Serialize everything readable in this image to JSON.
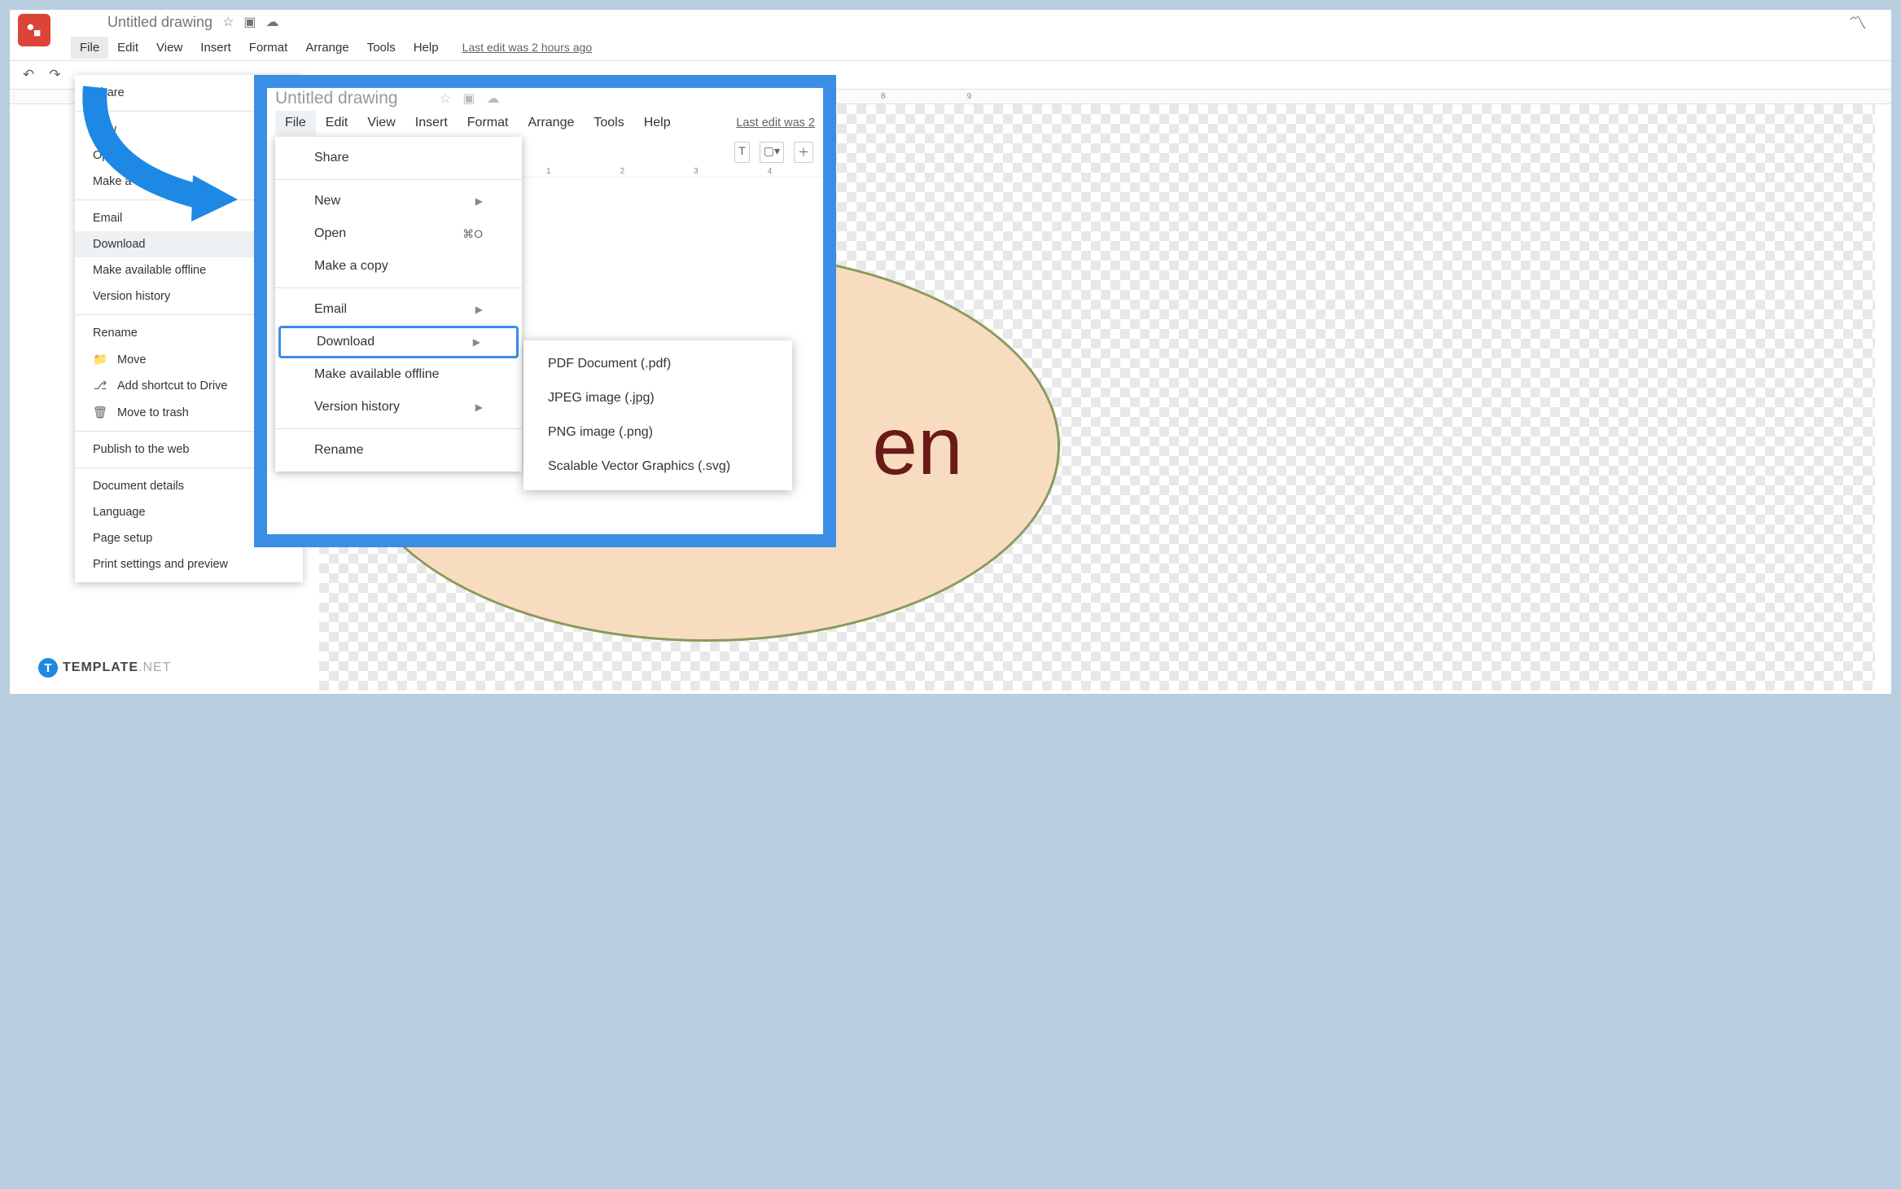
{
  "doc": {
    "title": "Untitled drawing"
  },
  "menubar": [
    "File",
    "Edit",
    "View",
    "Insert",
    "Format",
    "Arrange",
    "Tools",
    "Help"
  ],
  "last_edit": "Last edit was 2 hours ago",
  "file_menu": {
    "share": "Share",
    "new": "New",
    "open": "Open",
    "make_copy": "Make a copy",
    "email": "Email",
    "download": "Download",
    "offline": "Make available offline",
    "version": "Version history",
    "rename": "Rename",
    "move": "Move",
    "shortcut": "Add shortcut to Drive",
    "trash": "Move to trash",
    "publish": "Publish to the web",
    "doc_details": "Document details",
    "language": "Language",
    "page_setup": "Page setup",
    "print_settings": "Print settings and preview"
  },
  "callout": {
    "doc_title": "Untitled drawing",
    "menubar": [
      "File",
      "Edit",
      "View",
      "Insert",
      "Format",
      "Arrange",
      "Tools",
      "Help"
    ],
    "last_edit": "Last edit was 2",
    "open_shortcut": "⌘O"
  },
  "download_submenu": {
    "pdf": "PDF Document (.pdf)",
    "jpeg": "JPEG image (.jpg)",
    "png": "PNG image (.png)",
    "svg": "Scalable Vector Graphics (.svg)"
  },
  "oval_text": "en",
  "ruler_ticks": [
    "8",
    "9"
  ],
  "callout_ruler": [
    "1",
    "2",
    "3",
    "4"
  ],
  "watermark": {
    "brand": "TEMPLATE",
    "suffix": ".NET"
  }
}
